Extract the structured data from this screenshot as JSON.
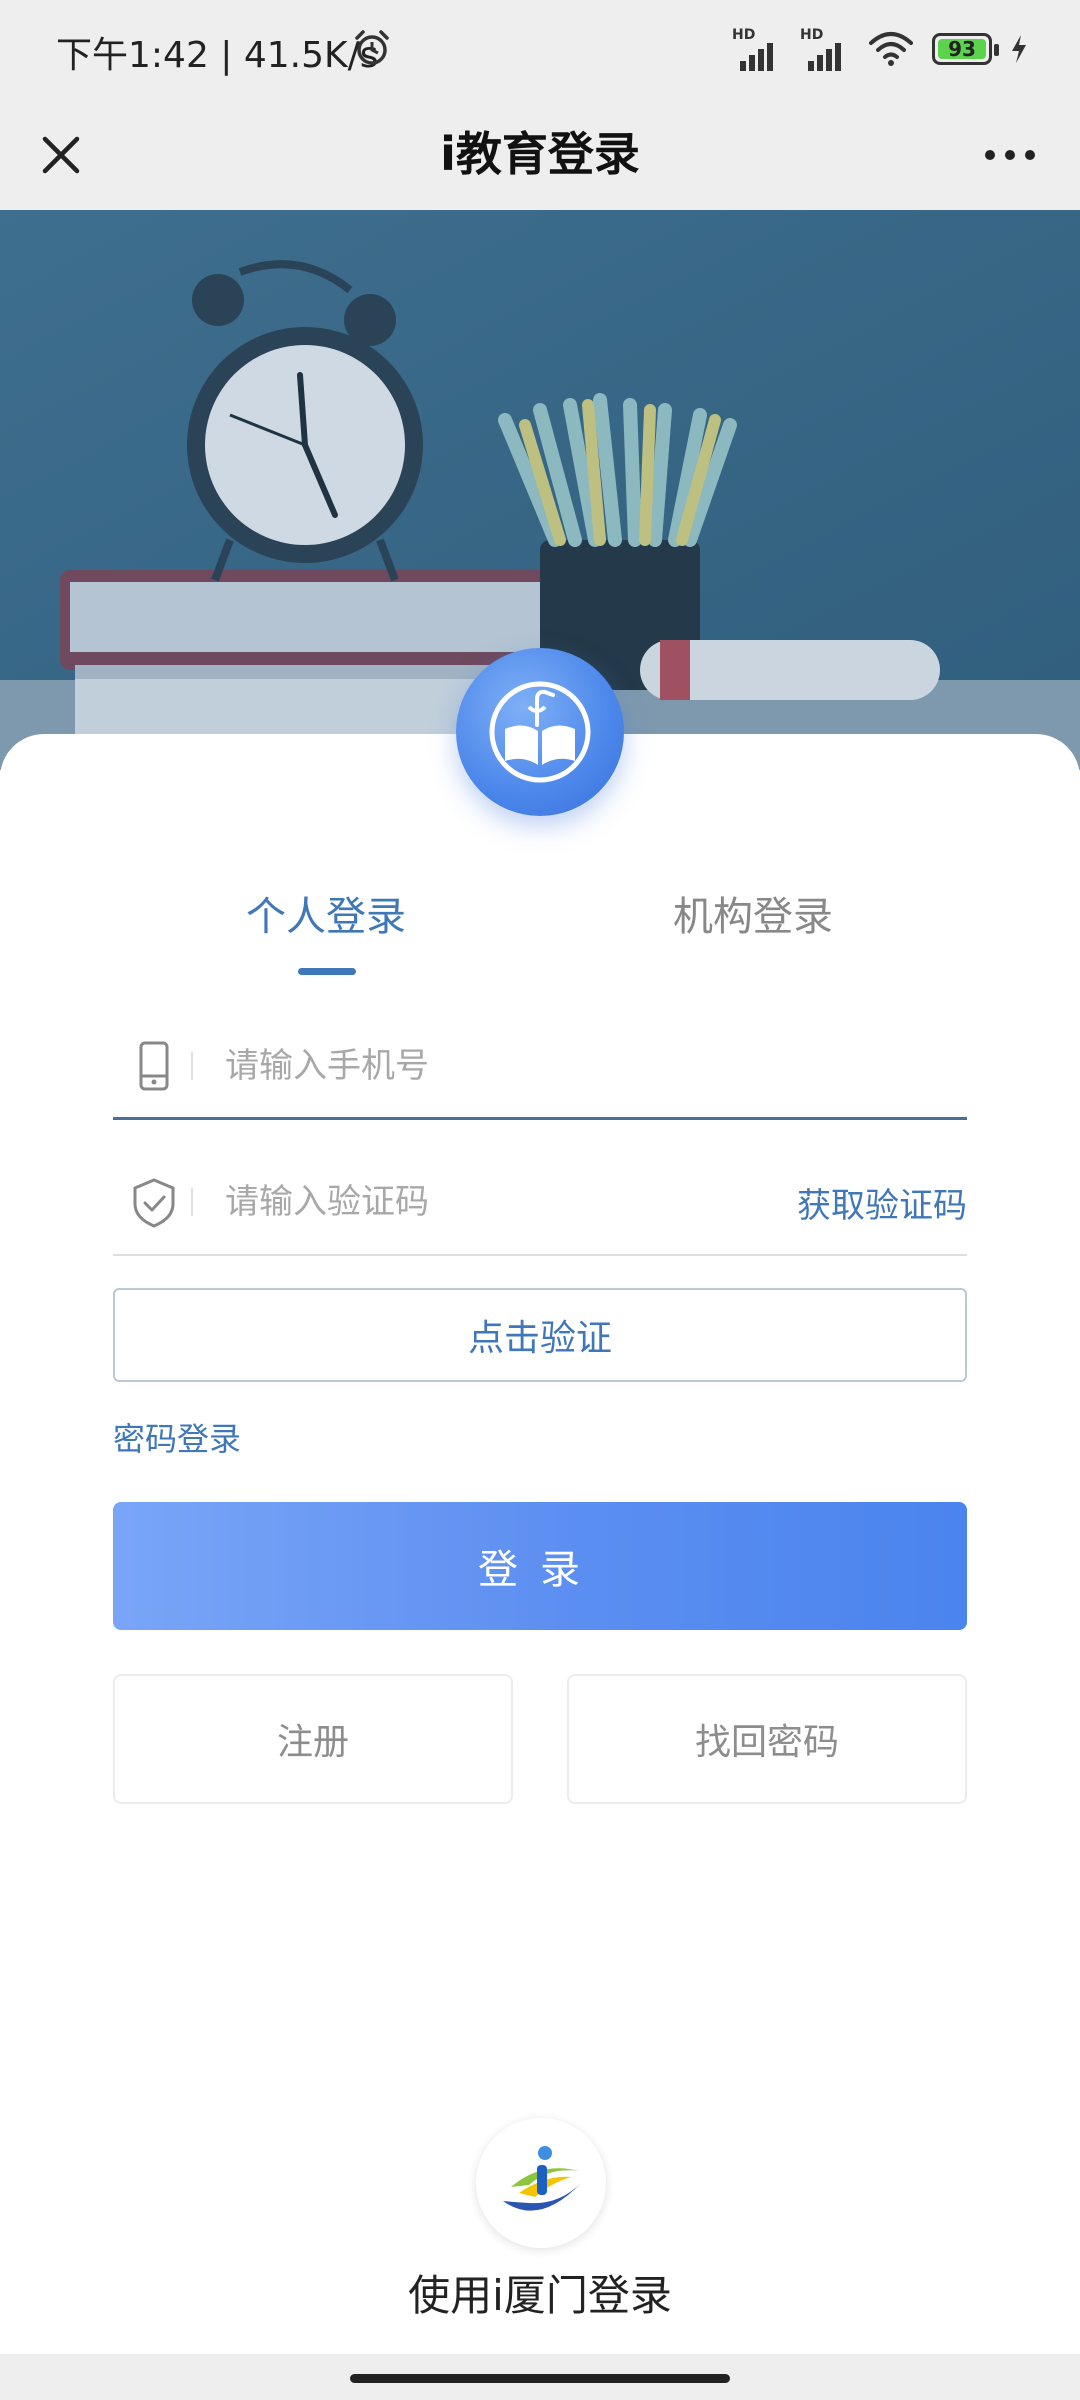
{
  "status_bar": {
    "time_speed": "下午1:42 | 41.5K/s",
    "battery": "93",
    "signal_label": "HD",
    "icons": [
      "alarm-icon",
      "signal-icon",
      "wifi-icon",
      "battery-icon",
      "charging-icon"
    ]
  },
  "title_bar": {
    "title": "i教育登录",
    "close_icon": "close-icon",
    "more_icon": "more-icon"
  },
  "login": {
    "tabs": [
      {
        "label": "个人登录",
        "active": true
      },
      {
        "label": "机构登录",
        "active": false
      }
    ],
    "phone_placeholder": "请输入手机号",
    "code_placeholder": "请输入验证码",
    "get_code": "获取验证码",
    "verify": "点击验证",
    "password_login": "密码登录",
    "submit": "登录",
    "register": "注册",
    "find_password": "找回密码"
  },
  "alt_login": {
    "label": "使用i厦门登录"
  },
  "colors": {
    "accent": "#3f77b8",
    "primary_button": "#5b8ef1",
    "bar_bg": "#eeeeee"
  }
}
